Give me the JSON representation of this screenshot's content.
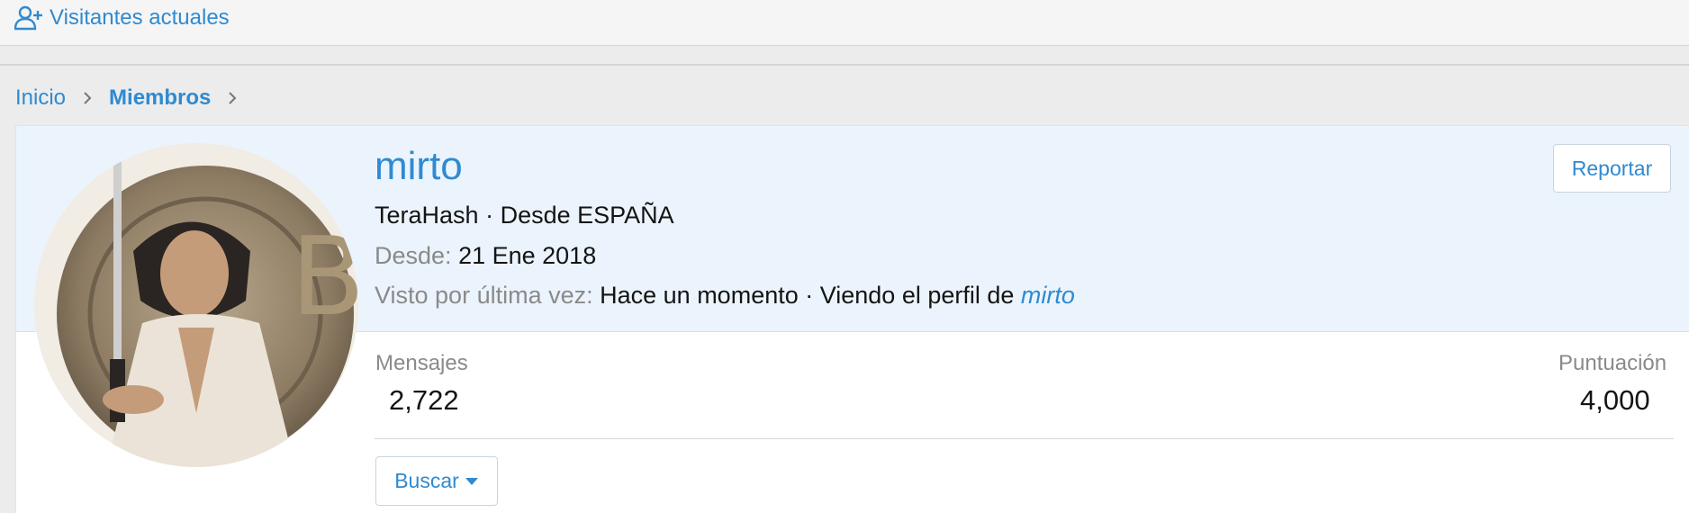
{
  "topbar": {
    "visitors_label": "Visitantes actuales"
  },
  "breadcrumb": {
    "items": [
      "Inicio",
      "Miembros"
    ]
  },
  "profile": {
    "username": "mirto",
    "rank": "TeraHash",
    "location_prefix": "Desde ESPAÑA",
    "joined_label": "Desde:",
    "joined_value": "21 Ene 2018",
    "last_seen_label": "Visto por última vez:",
    "last_seen_value": "Hace un momento · Viendo el perfil de",
    "last_seen_link": "mirto",
    "report_label": "Reportar"
  },
  "stats": {
    "messages_label": "Mensajes",
    "messages_value": "2,722",
    "score_label": "Puntuación",
    "score_value": "4,000"
  },
  "actions": {
    "search_label": "Buscar"
  },
  "colors": {
    "accent": "#2f8ad1",
    "header_bg": "#ebf4fc"
  }
}
